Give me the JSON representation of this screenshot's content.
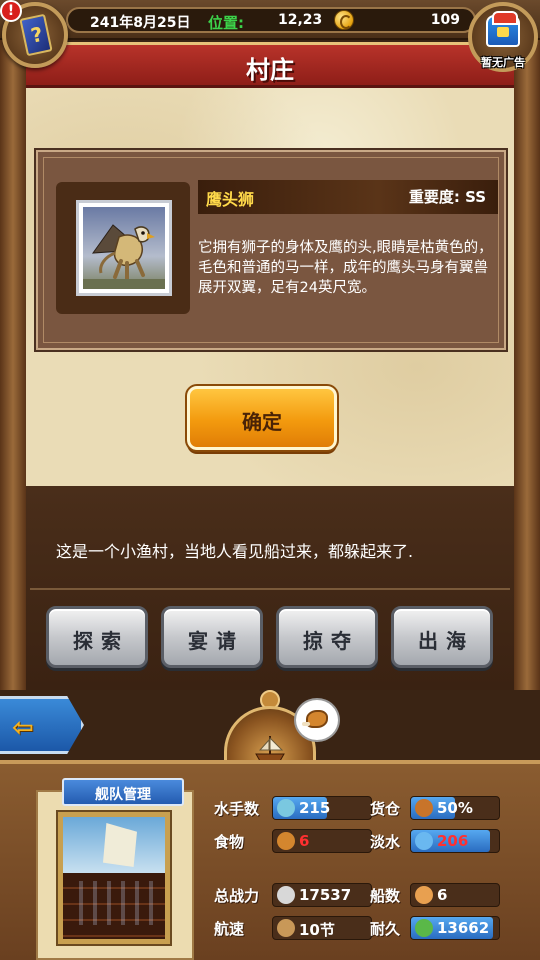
{
  "status": {
    "date": "241年8月25日",
    "position_label": "位置:",
    "position_value": "12,23",
    "gold": "109",
    "alert": "!",
    "ad_label": "暂无广告"
  },
  "dialog": {
    "title": "村庄",
    "creature_name": "鹰头狮",
    "importance": "重要度:   SS",
    "description": "它拥有狮子的身体及鹰的头,眼睛是枯黄色的，毛色和普通的马一样，成年的鹰头马身有翼兽展开双翼，足有24英尺宽。",
    "confirm_label": "确定"
  },
  "event": {
    "message": "这是一个小渔村，当地人看见船过来，都躲起来了."
  },
  "actions": [
    {
      "label": "探索"
    },
    {
      "label": "宴请"
    },
    {
      "label": "掠夺"
    },
    {
      "label": "出海"
    }
  ],
  "back_arrow": "⇦",
  "fleet": {
    "title": "舰队管理",
    "stats": [
      {
        "label": "水手数",
        "value": "215",
        "icon": "sailor-icon",
        "fill": 0.55,
        "red": false
      },
      {
        "label": "货仓",
        "value": "50%",
        "icon": "cargo-icon",
        "fill": 0.5,
        "red": false
      },
      {
        "label": "食物",
        "value": "6",
        "icon": "meat-icon",
        "fill": 0.0,
        "red": true
      },
      {
        "label": "淡水",
        "value": "206",
        "icon": "water-icon",
        "fill": 0.9,
        "red": true
      },
      {
        "label": "总战力",
        "value": "17537",
        "icon": "swords-icon",
        "fill": 0.0,
        "red": false
      },
      {
        "label": "船数",
        "value": "6",
        "icon": "boat-icon",
        "fill": 0.0,
        "red": false
      },
      {
        "label": "航速",
        "value": "10节",
        "icon": "speed-icon",
        "fill": 0.0,
        "red": false
      },
      {
        "label": "耐久",
        "value": "13662",
        "icon": "durability-icon",
        "fill": 0.93,
        "red": false
      }
    ]
  },
  "colors": {
    "accent_gold": "#ffd94a",
    "banner_red": "#b8332a",
    "position_green": "#3cd24a",
    "confirm_orange": "#f39a0e",
    "stat_blue": "#2a6cc0",
    "warning_red": "#ff3030"
  }
}
